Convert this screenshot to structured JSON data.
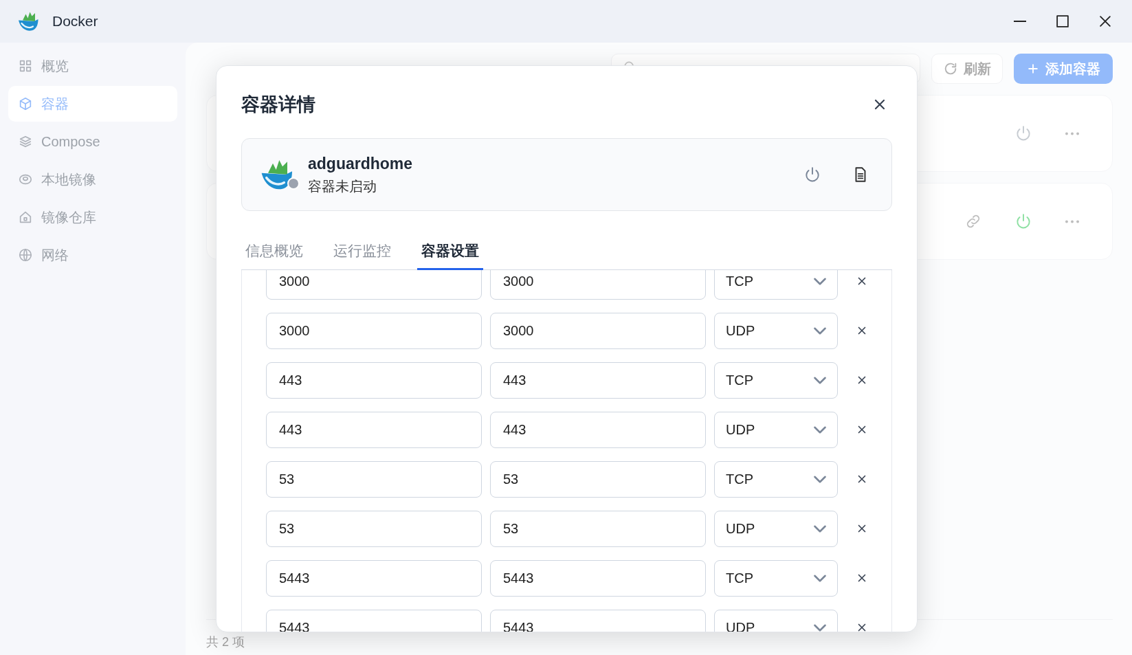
{
  "window": {
    "title": "Docker"
  },
  "sidebar": {
    "items": [
      {
        "label": "概览",
        "selected": false
      },
      {
        "label": "容器",
        "selected": true
      },
      {
        "label": "Compose",
        "selected": false
      },
      {
        "label": "本地镜像",
        "selected": false
      },
      {
        "label": "镜像仓库",
        "selected": false
      },
      {
        "label": "网络",
        "selected": false
      }
    ]
  },
  "page": {
    "refresh_button": "刷新",
    "add_button": "添加容器",
    "containers": [
      {
        "running": false
      },
      {
        "running": true
      }
    ],
    "footer": "共 2 项"
  },
  "dialog": {
    "title": "容器详情",
    "container": {
      "name": "adguardhome",
      "status": "容器未启动",
      "running": false
    },
    "tabs": [
      {
        "label": "信息概览",
        "selected": false
      },
      {
        "label": "运行监控",
        "selected": false
      },
      {
        "label": "容器设置",
        "selected": true
      }
    ],
    "ports": [
      {
        "host": "3000",
        "container": "3000",
        "protocol": "TCP"
      },
      {
        "host": "3000",
        "container": "3000",
        "protocol": "UDP"
      },
      {
        "host": "443",
        "container": "443",
        "protocol": "TCP"
      },
      {
        "host": "443",
        "container": "443",
        "protocol": "UDP"
      },
      {
        "host": "53",
        "container": "53",
        "protocol": "TCP"
      },
      {
        "host": "53",
        "container": "53",
        "protocol": "UDP"
      },
      {
        "host": "5443",
        "container": "5443",
        "protocol": "TCP"
      },
      {
        "host": "5443",
        "container": "5443",
        "protocol": "UDP"
      }
    ]
  }
}
